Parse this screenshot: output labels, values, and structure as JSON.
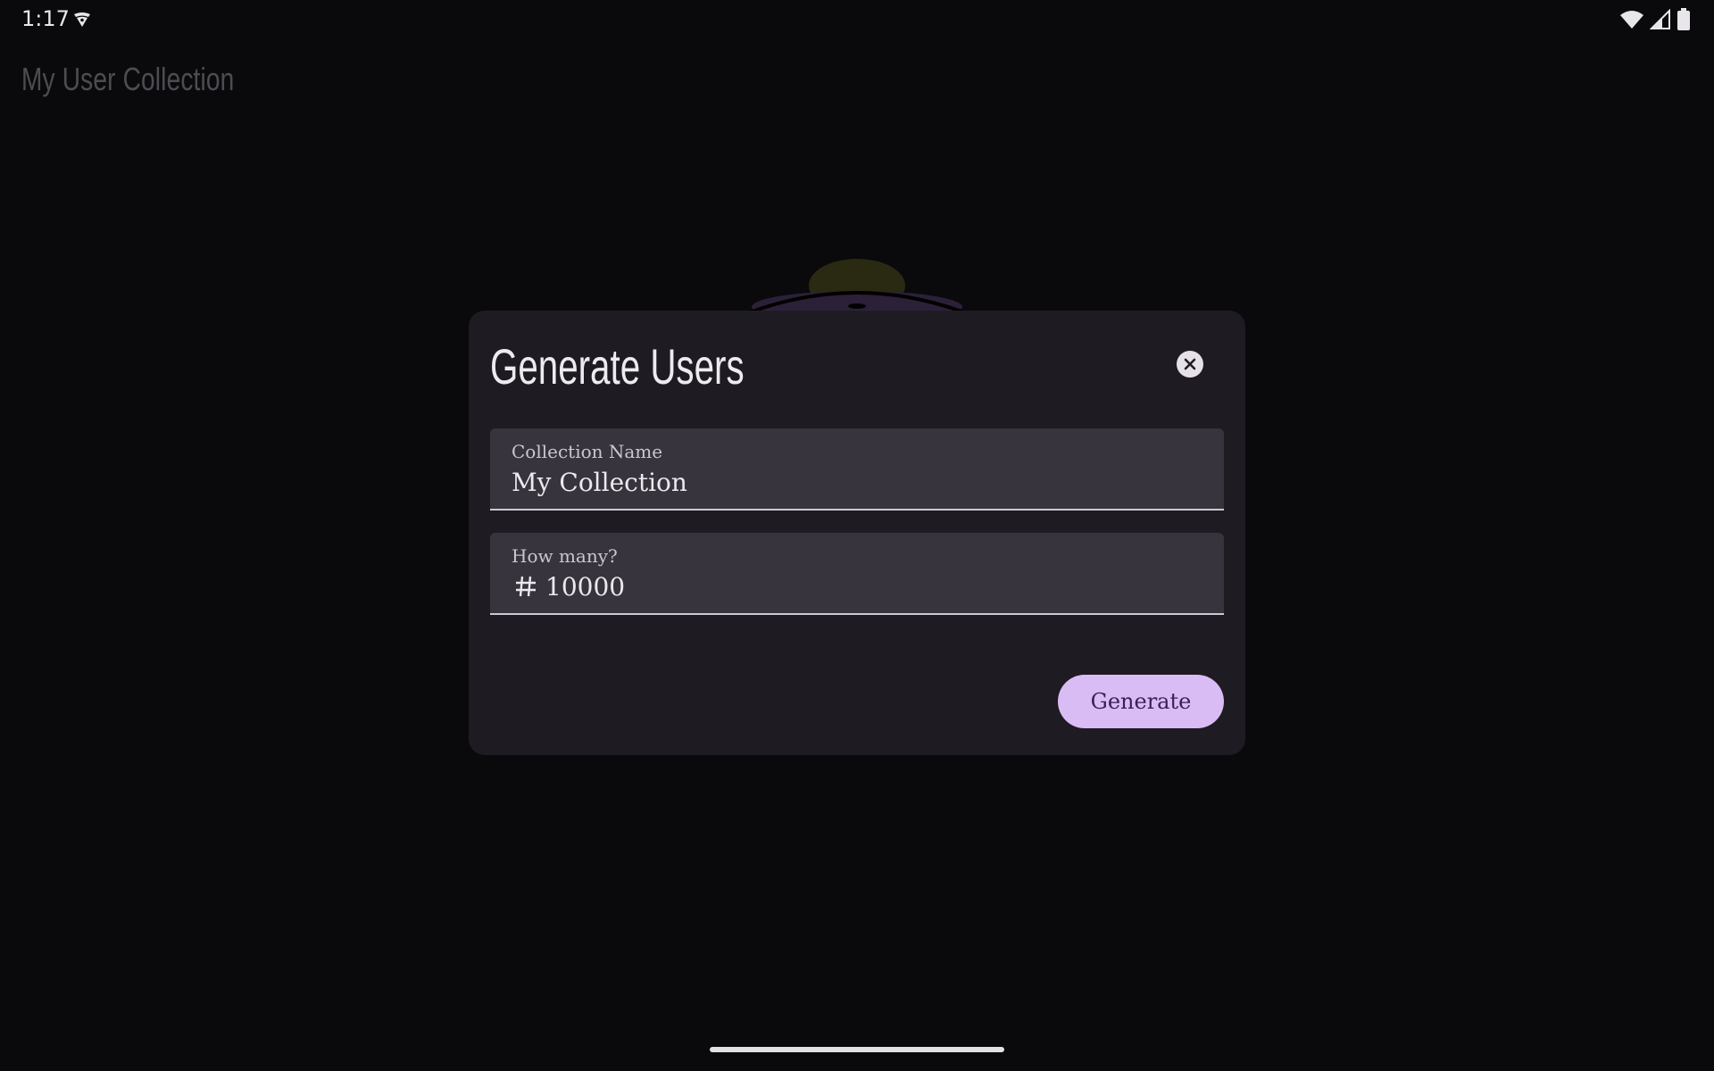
{
  "status_bar": {
    "time": "1:17",
    "icons": [
      "vpn-key-icon",
      "wifi-icon",
      "cellular-signal-icon",
      "battery-icon"
    ]
  },
  "app": {
    "title": "My User Collection"
  },
  "dialog": {
    "title": "Generate Users",
    "close_icon": "close-circle-icon",
    "fields": {
      "collection_name": {
        "label": "Collection Name",
        "value": "My Collection"
      },
      "count": {
        "label": "How many?",
        "icon": "hash-icon",
        "value": "10000"
      }
    },
    "generate_label": "Generate"
  },
  "colors": {
    "background": "#0a0a0d",
    "dialog": "#1f1b22",
    "field": "#38343d",
    "button": "#dabcf5",
    "button_text": "#3a1f55"
  }
}
